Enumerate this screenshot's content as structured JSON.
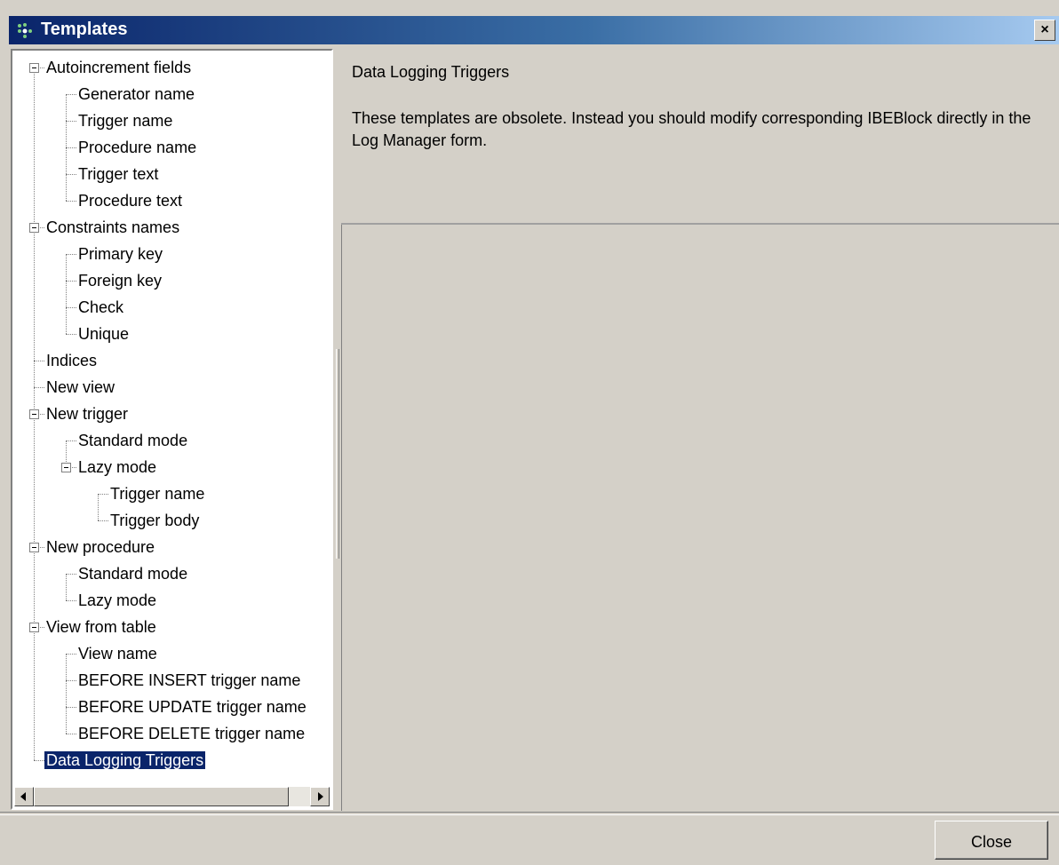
{
  "window": {
    "title": "Templates",
    "close_glyph": "×"
  },
  "tree": {
    "items": [
      {
        "label": "Autoincrement fields",
        "level": 0,
        "expanded": true
      },
      {
        "label": "Generator name",
        "level": 1
      },
      {
        "label": "Trigger name",
        "level": 1
      },
      {
        "label": "Procedure name",
        "level": 1
      },
      {
        "label": "Trigger text",
        "level": 1
      },
      {
        "label": "Procedure text",
        "level": 1
      },
      {
        "label": "Constraints names",
        "level": 0,
        "expanded": true
      },
      {
        "label": "Primary key",
        "level": 1
      },
      {
        "label": "Foreign key",
        "level": 1
      },
      {
        "label": "Check",
        "level": 1
      },
      {
        "label": "Unique",
        "level": 1
      },
      {
        "label": "Indices",
        "level": 0
      },
      {
        "label": "New view",
        "level": 0
      },
      {
        "label": "New trigger",
        "level": 0,
        "expanded": true
      },
      {
        "label": "Standard mode",
        "level": 1
      },
      {
        "label": "Lazy mode",
        "level": 1,
        "expanded": true
      },
      {
        "label": "Trigger name",
        "level": 2
      },
      {
        "label": "Trigger body",
        "level": 2
      },
      {
        "label": "New procedure",
        "level": 0,
        "expanded": true
      },
      {
        "label": "Standard mode",
        "level": 1
      },
      {
        "label": "Lazy mode",
        "level": 1
      },
      {
        "label": "View from table",
        "level": 0,
        "expanded": true
      },
      {
        "label": "View name",
        "level": 1
      },
      {
        "label": "BEFORE INSERT trigger name",
        "level": 1
      },
      {
        "label": "BEFORE UPDATE trigger name",
        "level": 1
      },
      {
        "label": "BEFORE DELETE trigger name",
        "level": 1
      },
      {
        "label": "Data Logging Triggers",
        "level": 0,
        "selected": true
      }
    ]
  },
  "description": {
    "title": "Data Logging Triggers",
    "body": "These templates are obsolete. Instead you should modify corresponding IBEBlock directly in the Log Manager form."
  },
  "buttons": {
    "close_label": "Close"
  },
  "colors": {
    "selection": "#0a246a",
    "titlebar_start": "#0a246a",
    "titlebar_end": "#a6caf0"
  }
}
